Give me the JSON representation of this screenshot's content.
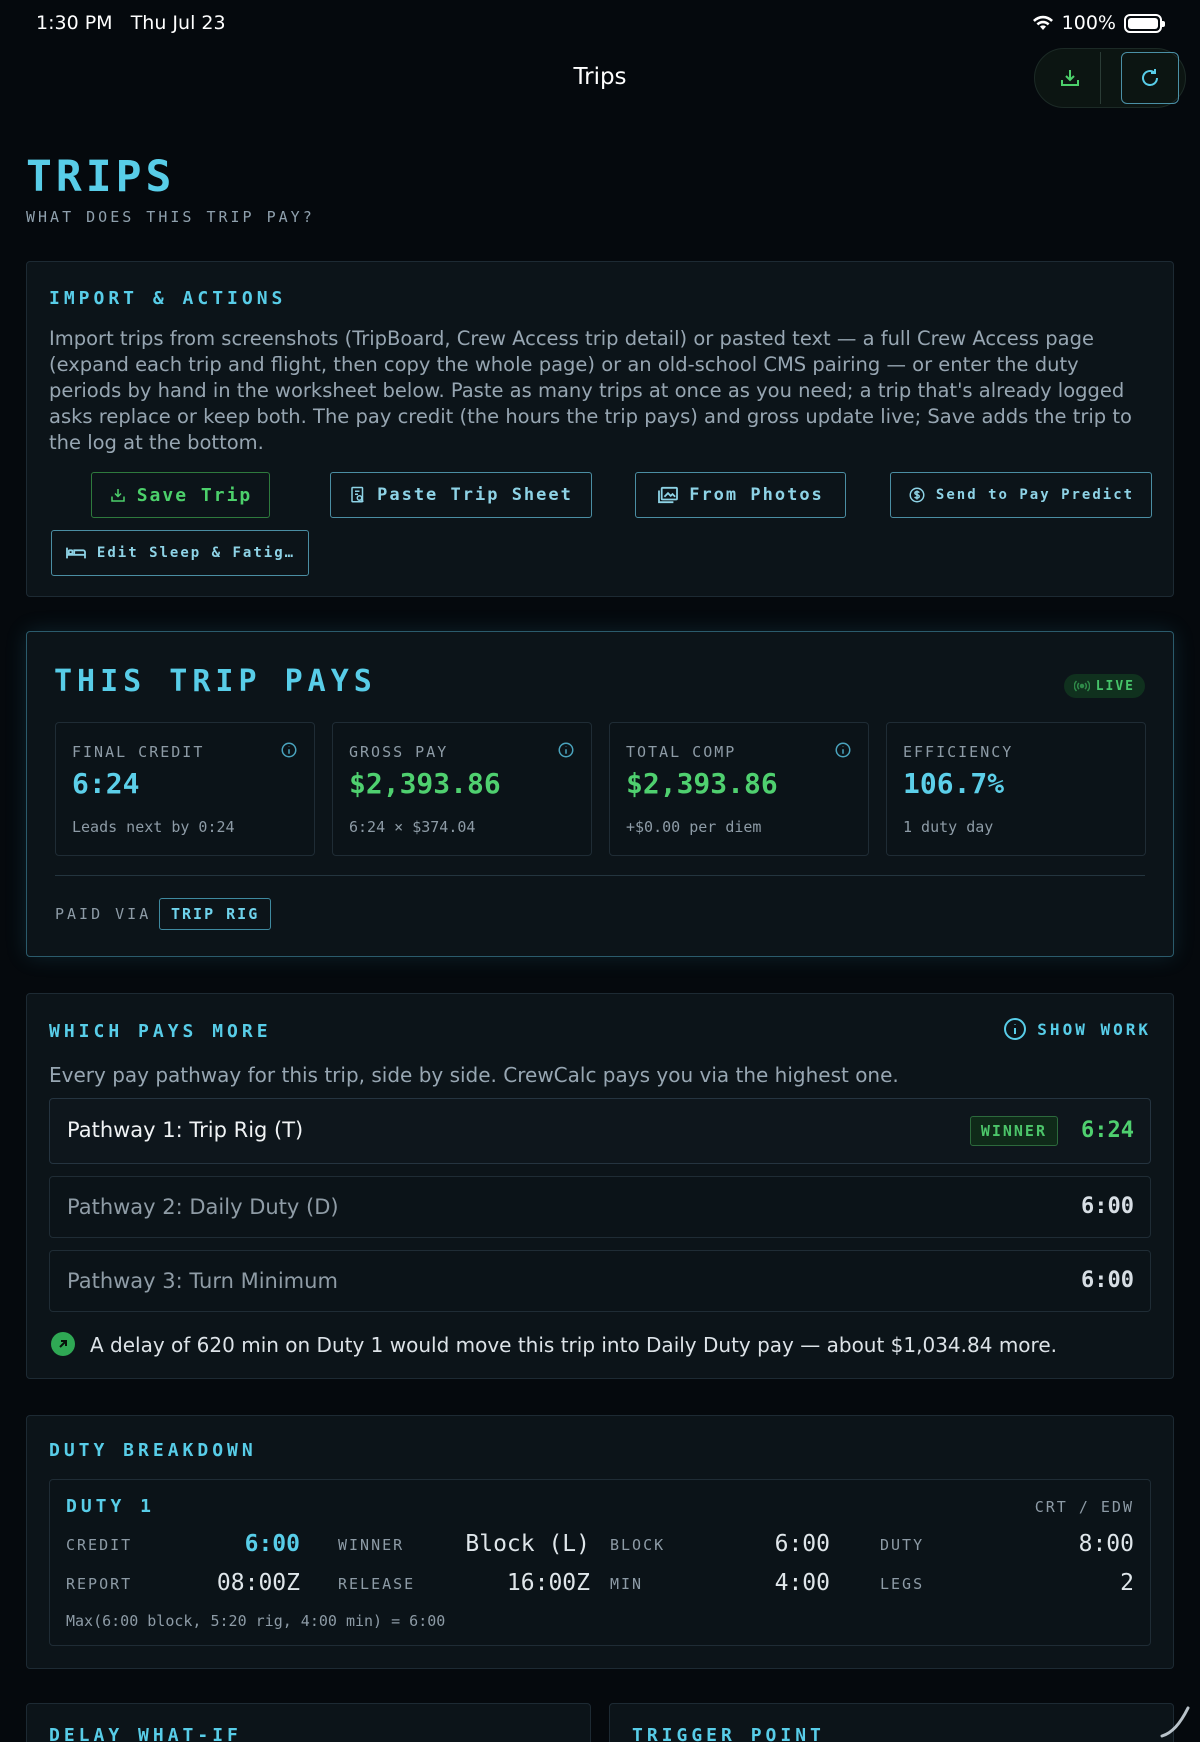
{
  "status": {
    "time": "1:30 PM",
    "date": "Thu Jul 23",
    "battery": "100%"
  },
  "nav": {
    "title": "Trips",
    "icons": [
      "download-icon",
      "refresh-icon"
    ]
  },
  "header": {
    "title": "TRIPS",
    "subtitle": "WHAT DOES THIS TRIP PAY?"
  },
  "import": {
    "title": "IMPORT & ACTIONS",
    "lines": [
      "Import trips from screenshots (TripBoard, Crew Access trip detail) or pasted text — a full Crew Access page",
      "(expand each trip and flight, then copy the whole page) or an old-school CMS pairing — or enter the duty",
      "periods by hand in the worksheet below. Paste as many trips at once as you need; a trip that's already logged",
      "asks replace or keep both. The pay credit (the hours the trip pays) and gross update live; Save adds the trip to",
      "the log at the bottom."
    ],
    "buttons": {
      "save": "Save Trip",
      "paste": "Paste Trip Sheet",
      "photos": "From Photos",
      "send": "Send to Pay Predict",
      "sleep": "Edit Sleep & Fatig…"
    }
  },
  "pays": {
    "title": "THIS TRIP PAYS",
    "live": "LIVE",
    "stats": [
      {
        "label": "FINAL CREDIT",
        "value": "6:24",
        "note": "Leads next by 0:24",
        "color": "#5ccfe9"
      },
      {
        "label": "GROSS PAY",
        "value": "$2,393.86",
        "note": "6:24 × $374.04",
        "color": "#4fd06f"
      },
      {
        "label": "TOTAL COMP",
        "value": "$2,393.86",
        "note": "+$0.00 per diem",
        "color": "#4fd06f"
      },
      {
        "label": "EFFICIENCY",
        "value": "106.7%",
        "note": "1 duty day",
        "color": "#5ccfe9"
      }
    ],
    "paid_via_label": "PAID VIA",
    "paid_via": "TRIP RIG"
  },
  "which": {
    "title": "WHICH PAYS MORE",
    "show_work": "SHOW WORK",
    "desc": "Every pay pathway for this trip, side by side. CrewCalc pays you via the highest one.",
    "pathways": [
      {
        "name": "Pathway 1: Trip Rig (T)",
        "badge": "WINNER",
        "value": "6:24"
      },
      {
        "name": "Pathway 2: Daily Duty (D)",
        "value": "6:00"
      },
      {
        "name": "Pathway 3: Turn Minimum",
        "value": "6:00"
      }
    ],
    "hint": "A delay of 620 min on Duty 1 would move this trip into Daily Duty pay — about $1,034.84 more."
  },
  "duty": {
    "title": "DUTY BREAKDOWN",
    "duty_title": "DUTY 1",
    "crt_edw": "CRT / EDW",
    "labels": {
      "credit": "CREDIT",
      "winner": "WINNER",
      "block": "BLOCK",
      "duty": "DUTY",
      "report": "REPORT",
      "release": "RELEASE",
      "min": "MIN",
      "legs": "LEGS"
    },
    "values": {
      "credit": "6:00",
      "winner": "Block (L)",
      "block": "6:00",
      "duty": "8:00",
      "report": "08:00Z",
      "release": "16:00Z",
      "min": "4:00",
      "legs": "2"
    },
    "formula": "Max(6:00 block, 5:20 rig, 4:00 min) = 6:00"
  },
  "bottom": {
    "left": "DELAY WHAT-IF",
    "right": "TRIGGER POINT"
  }
}
